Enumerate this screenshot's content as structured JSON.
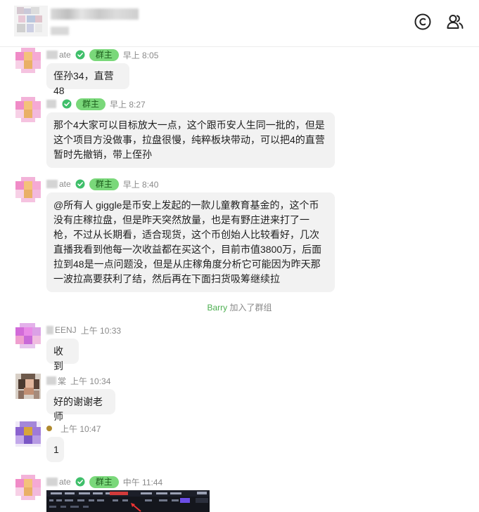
{
  "header": {
    "group_icons": [
      "copyright-icon",
      "members-icon"
    ]
  },
  "messages": [
    {
      "name_suffix": "ate",
      "badge": "群主",
      "verified": true,
      "time": "早上 8:05",
      "text": "侄孙34，直营48"
    },
    {
      "name_suffix": "",
      "badge": "群主",
      "verified": true,
      "time": "早上 8:27",
      "text": "那个4大家可以目标放大一点，这个跟币安人生同一批的，但是这个项目方没做事，拉盘很慢，纯粹板块带动，可以把4的直营暂时先撤销，带上侄孙"
    },
    {
      "name_suffix": "ate",
      "badge": "群主",
      "verified": true,
      "time": "早上 8:40",
      "text": "@所有人 giggle是币安上发起的一款儿童教育基金的，这个币没有庄稼拉盘，但是昨天突然放量，也是有野庄进来打了一枪，不过从长期看，适合现货，这个币创始人比较看好，几次直播我看到他每一次收益都在买这个，目前市值3800万，后面拉到48是一点问题没，但是从庄稼角度分析它可能因为昨天那一波拉高要获利了结，然后再在下面扫货吸筹继续拉"
    },
    {
      "name_suffix": "EENJ",
      "time": "上午 10:33",
      "text": "收到"
    },
    {
      "name_suffix": "棠",
      "time": "上午 10:34",
      "text": "好的谢谢老师"
    },
    {
      "name_suffix": "",
      "time": "上午 10:47",
      "text": "1"
    },
    {
      "name_suffix": "ate",
      "badge": "群主",
      "verified": true,
      "time": "中午 11:44",
      "text": ""
    }
  ],
  "system": {
    "name": "Barry",
    "action": "加入了群组"
  },
  "colors": {
    "badge_bg": "#7ad87a",
    "badge_text": "#1d5f1d",
    "verified": "#3fbf6a",
    "bubble": "#f2f2f2",
    "system_name": "#4caf50"
  }
}
